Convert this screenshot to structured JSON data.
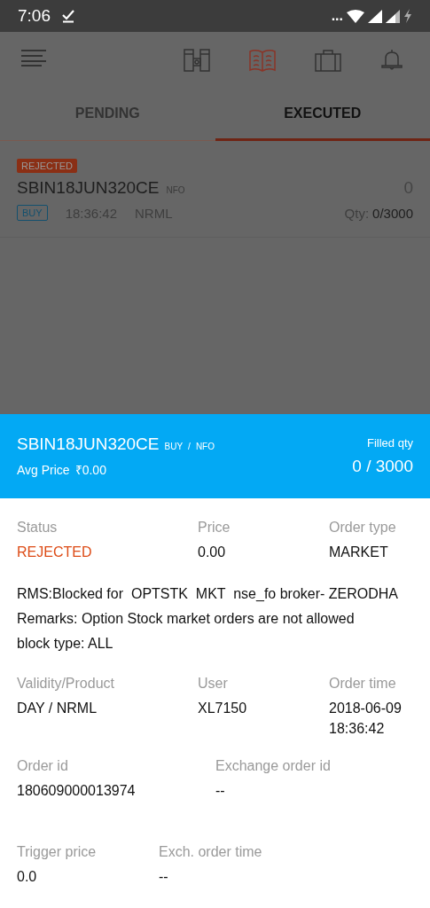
{
  "status_bar": {
    "time": "7:06",
    "more": "..."
  },
  "nav_icons": [
    {
      "kind": "binoculars",
      "selected": false
    },
    {
      "kind": "book",
      "selected": true
    },
    {
      "kind": "briefcase",
      "selected": false
    },
    {
      "kind": "bell",
      "selected": false
    }
  ],
  "tabs": [
    {
      "label": "PENDING",
      "selected": false
    },
    {
      "label": "EXECUTED",
      "selected": true
    }
  ],
  "order": {
    "status": "REJECTED",
    "symbol": "SBIN18JUN320CE",
    "exchange": "NFO",
    "price": "0",
    "side": "BUY",
    "time": "18:36:42",
    "product": "NRML",
    "qty_label": "Qty:",
    "qty_value": "0/3000"
  },
  "sheet": {
    "symbol": "SBIN18JUN320CE",
    "side": "BUY",
    "separator": "/",
    "exchange": "NFO",
    "avg_label": "Avg Price",
    "avg_value": "₹0.00",
    "filled_label": "Filled qty",
    "filled_value": "0 / 3000"
  },
  "details": [
    {
      "kind": "triple",
      "fields": [
        {
          "label": "Status",
          "value": "REJECTED",
          "kind": "status"
        },
        {
          "label": "Price",
          "value": "0.00",
          "kind": "plain"
        },
        {
          "label": "Order type",
          "value": "MARKET",
          "kind": "plain"
        }
      ]
    },
    {
      "kind": "message",
      "lines": [
        "RMS:Blocked for  OPTSTK  MKT  nse_fo broker- ZERODHA",
        "Remarks: Option Stock market orders are not allowed",
        "block type: ALL"
      ]
    },
    {
      "kind": "triple",
      "fields": [
        {
          "label": "Validity/Product",
          "value": "DAY / NRML",
          "kind": "plain"
        },
        {
          "label": "User",
          "value": "XL7150",
          "kind": "plain"
        },
        {
          "label": "Order time",
          "value": "2018-06-09 18:36:42",
          "kind": "plain"
        }
      ]
    },
    {
      "kind": "pair",
      "fields": [
        {
          "label": "Order id",
          "value": "180609000013974",
          "kind": "plain"
        },
        {
          "label": "Exchange order id",
          "value": "--",
          "kind": "plain"
        }
      ]
    },
    {
      "kind": "spaced",
      "fields": [
        {
          "label": "Trigger price",
          "value": "0.0",
          "kind": "plain"
        },
        {
          "label": "Exch. order time",
          "value": "--",
          "kind": "plain"
        }
      ]
    }
  ]
}
